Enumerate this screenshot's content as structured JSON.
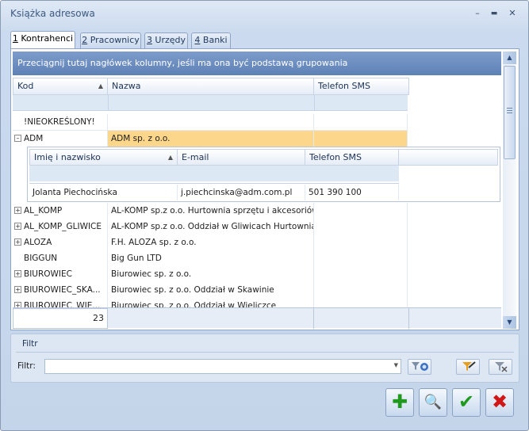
{
  "window": {
    "title": "Książka adresowa",
    "minimize": "–",
    "maximize": "▬",
    "close": "✕"
  },
  "tabs": [
    {
      "key": "1",
      "label": " Kontrahenci"
    },
    {
      "key": "2",
      "label": " Pracownicy"
    },
    {
      "key": "3",
      "label": " Urzędy"
    },
    {
      "key": "4",
      "label": " Banki"
    }
  ],
  "grid": {
    "group_hint": "Przeciągnij tutaj nagłówek kolumny, jeśli ma ona być podstawą grupowania",
    "columns": {
      "kod": "Kod",
      "nazwa": "Nazwa",
      "telefon": "Telefon SMS"
    },
    "rows": [
      {
        "kod": "!NIEOKREŚLONY!",
        "nazwa": ""
      },
      {
        "kod": "ADM",
        "nazwa": "ADM sp. z o.o."
      },
      {
        "kod": "AL_KOMP",
        "nazwa": "AL-KOMP sp.z o.o. Hurtownia sprzętu i akcesoriów..."
      },
      {
        "kod": "AL_KOMP_GLIWICE",
        "nazwa": "AL-KOMP sp.z o.o. Oddział w Gliwicach Hurtownia ..."
      },
      {
        "kod": "ALOZA",
        "nazwa": "F.H. ALOZA sp. z o.o."
      },
      {
        "kod": "BIGGUN",
        "nazwa": "Big Gun LTD"
      },
      {
        "kod": "BIUROWIEC",
        "nazwa": "Biurowiec sp. z o.o."
      },
      {
        "kod": "BIUROWIEC_SKA...",
        "nazwa": "Biurowiec sp. z o.o. Oddział w Skawinie"
      },
      {
        "kod": "BIUROWIEC_WIE...",
        "nazwa": "Biurowiec sp. z o.o. Oddział w Wieliczce"
      }
    ],
    "detail": {
      "columns": {
        "imie": "Imię i nazwisko",
        "email": "E-mail",
        "telefon": "Telefon SMS"
      },
      "row": {
        "imie": "Jolanta Piechocińska",
        "email": "j.piechcinska@adm.com.pl",
        "telefon": "501 390 100"
      }
    },
    "count": "23"
  },
  "filter": {
    "section_label": "Filtr",
    "label": "Filtr:",
    "value": ""
  },
  "actions": {
    "add": "✚",
    "edit": "🔍",
    "ok": "✔",
    "cancel": "✖"
  },
  "colors": {
    "accent": "#5e81b6",
    "selection": "#fcd68b",
    "add": "#1f9a1f",
    "ok": "#1f9a1f",
    "cancel": "#d01818"
  }
}
